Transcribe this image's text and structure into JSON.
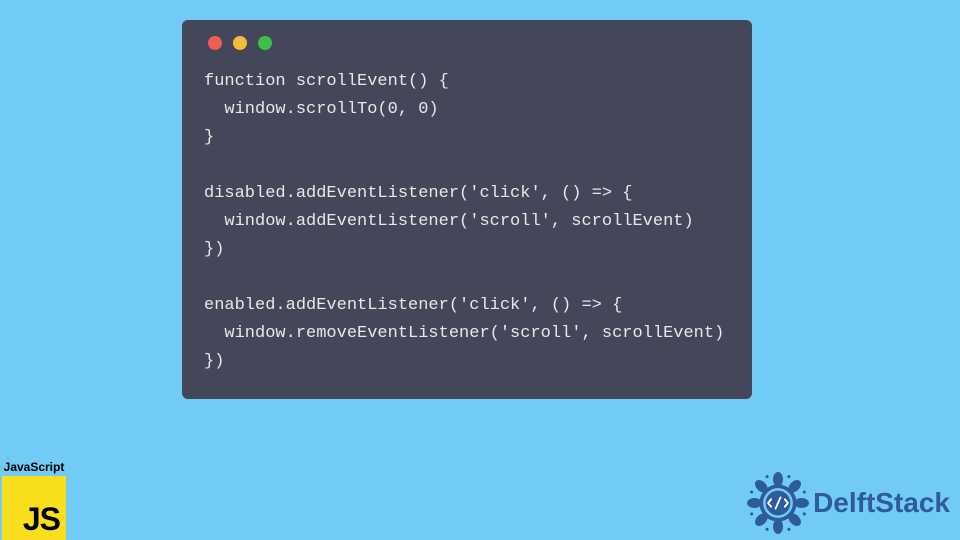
{
  "code": {
    "lines": [
      "function scrollEvent() {",
      "  window.scrollTo(0, 0)",
      "}",
      "",
      "disabled.addEventListener('click', () => {",
      "  window.addEventListener('scroll', scrollEvent)",
      "})",
      "",
      "enabled.addEventListener('click', () => {",
      "  window.removeEventListener('scroll', scrollEvent)",
      "})"
    ]
  },
  "window_controls": {
    "red": "#ec5e50",
    "yellow": "#f1bc36",
    "green": "#3cc048"
  },
  "js_badge": {
    "label": "JavaScript",
    "icon_text": "JS"
  },
  "brand": {
    "name": "DelftStack",
    "color": "#2e5b9c"
  }
}
